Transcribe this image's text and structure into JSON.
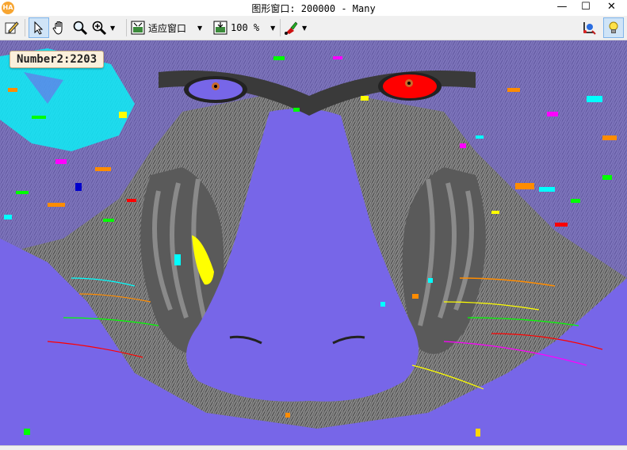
{
  "window": {
    "title": "图形窗口: 200000 - Many",
    "app_icon_text": "HA",
    "minimize_glyph": "—",
    "maximize_glyph": "☐",
    "close_glyph": "✕"
  },
  "toolbar": {
    "fit_window_label": "适应窗口",
    "zoom_value": "100 %"
  },
  "canvas": {
    "overlay_label": "Number2:2203",
    "region_color": "#7766e8",
    "highlight_colors": [
      "#ff0000",
      "#ffff00",
      "#00ffff",
      "#00ff00",
      "#ff00ff",
      "#ff8c00"
    ]
  }
}
